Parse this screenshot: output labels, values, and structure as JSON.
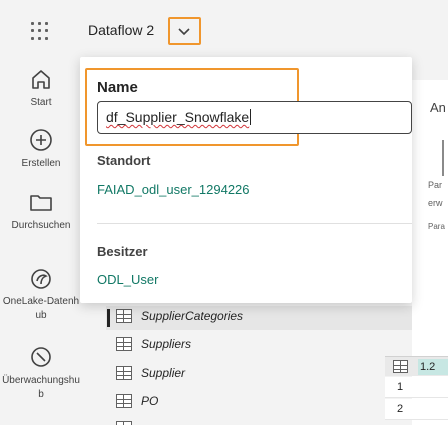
{
  "header": {
    "title": "Dataflow 2"
  },
  "nav": [
    {
      "label": "Start",
      "icon": "home-icon"
    },
    {
      "label": "Erstellen",
      "icon": "plus-circle-icon"
    },
    {
      "label": "Durchsuchen",
      "icon": "folder-icon"
    },
    {
      "label": "OneLake-Datenhub",
      "icon": "onelake-icon"
    },
    {
      "label": "Überwachungshub",
      "icon": "monitor-icon"
    }
  ],
  "popup": {
    "name_label": "Name",
    "name_value": "df_Supplier_Snowflake",
    "location_label": "Standort",
    "location_value": "FAIAD_odl_user_1294226",
    "owner_label": "Besitzer",
    "owner_value": "ODL_User"
  },
  "tree": {
    "items": [
      "SupplierCategories",
      "Suppliers",
      "Supplier",
      "PO"
    ]
  },
  "grid": {
    "type_label": "1.2",
    "rows": [
      "1",
      "2"
    ]
  },
  "fragments": {
    "an": "An",
    "par": "Par",
    "erw": "erw",
    "para": "Para"
  },
  "colors": {
    "highlight": "#f0962d",
    "link_text": "#117865",
    "spellcheck": "#d13438"
  }
}
